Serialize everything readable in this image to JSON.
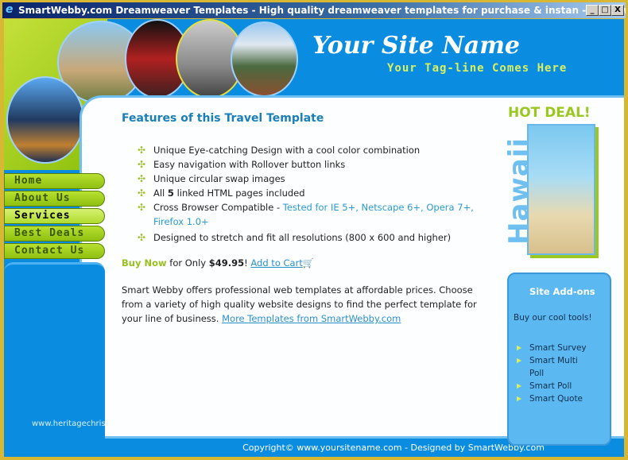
{
  "window": {
    "title": "SmartWebby.com Dreamweaver Templates - High quality dreamweaver templates for purchase & instan - Windows Interne...",
    "minimize": "_",
    "maximize": "□",
    "close": "X"
  },
  "header": {
    "site_name": "Your Site Name",
    "tagline": "Your Tag-line Comes Here"
  },
  "nav": {
    "items": [
      {
        "label": "Home"
      },
      {
        "label": "About Us"
      },
      {
        "label": "Services"
      },
      {
        "label": "Best Deals"
      },
      {
        "label": "Contact Us"
      }
    ],
    "active": "Services"
  },
  "main": {
    "title": "Features of this Travel Template",
    "features": [
      "Unique Eye-catching Design with a cool color combination",
      "Easy navigation with Rollover button links",
      "Unique circular swap images",
      {
        "pre": "All ",
        "bold": "5",
        "post": " linked HTML pages included"
      },
      {
        "pre": "Cross Browser Compatible - ",
        "highlight": "Tested for IE 5+, Netscape 6+, Opera 7+, Firefox 1.0+"
      },
      "Designed to stretch and fit all resolutions (800 x 600 and higher)"
    ],
    "buy": {
      "label": "Buy Now",
      "text": " for Only ",
      "price": "$49.95",
      "bang": "! ",
      "cart_link": "Add to Cart"
    },
    "description": "Smart Webby offers professional web templates at affordable prices. Choose from a variety of high quality website designs to find the perfect template for your line of business. ",
    "more_link": "More Templates from SmartWebby.com"
  },
  "promo": {
    "hot_deal": "HOT DEAL!",
    "destination": "Hawaii"
  },
  "addons": {
    "title": "Site Add-ons",
    "subtitle": "Buy our cool tools!",
    "items": [
      "Smart Survey",
      "Smart Multi Poll",
      "Smart Poll",
      "Smart Quote"
    ]
  },
  "watermark": "www.heritagechristiancollege.com",
  "footer": {
    "copyright": "Copyright© www.yoursitename.com - Designed by SmartWebby.com"
  },
  "colors": {
    "accent_green": "#9ac820",
    "blue": "#0a8de0",
    "link": "#2a90c8"
  }
}
